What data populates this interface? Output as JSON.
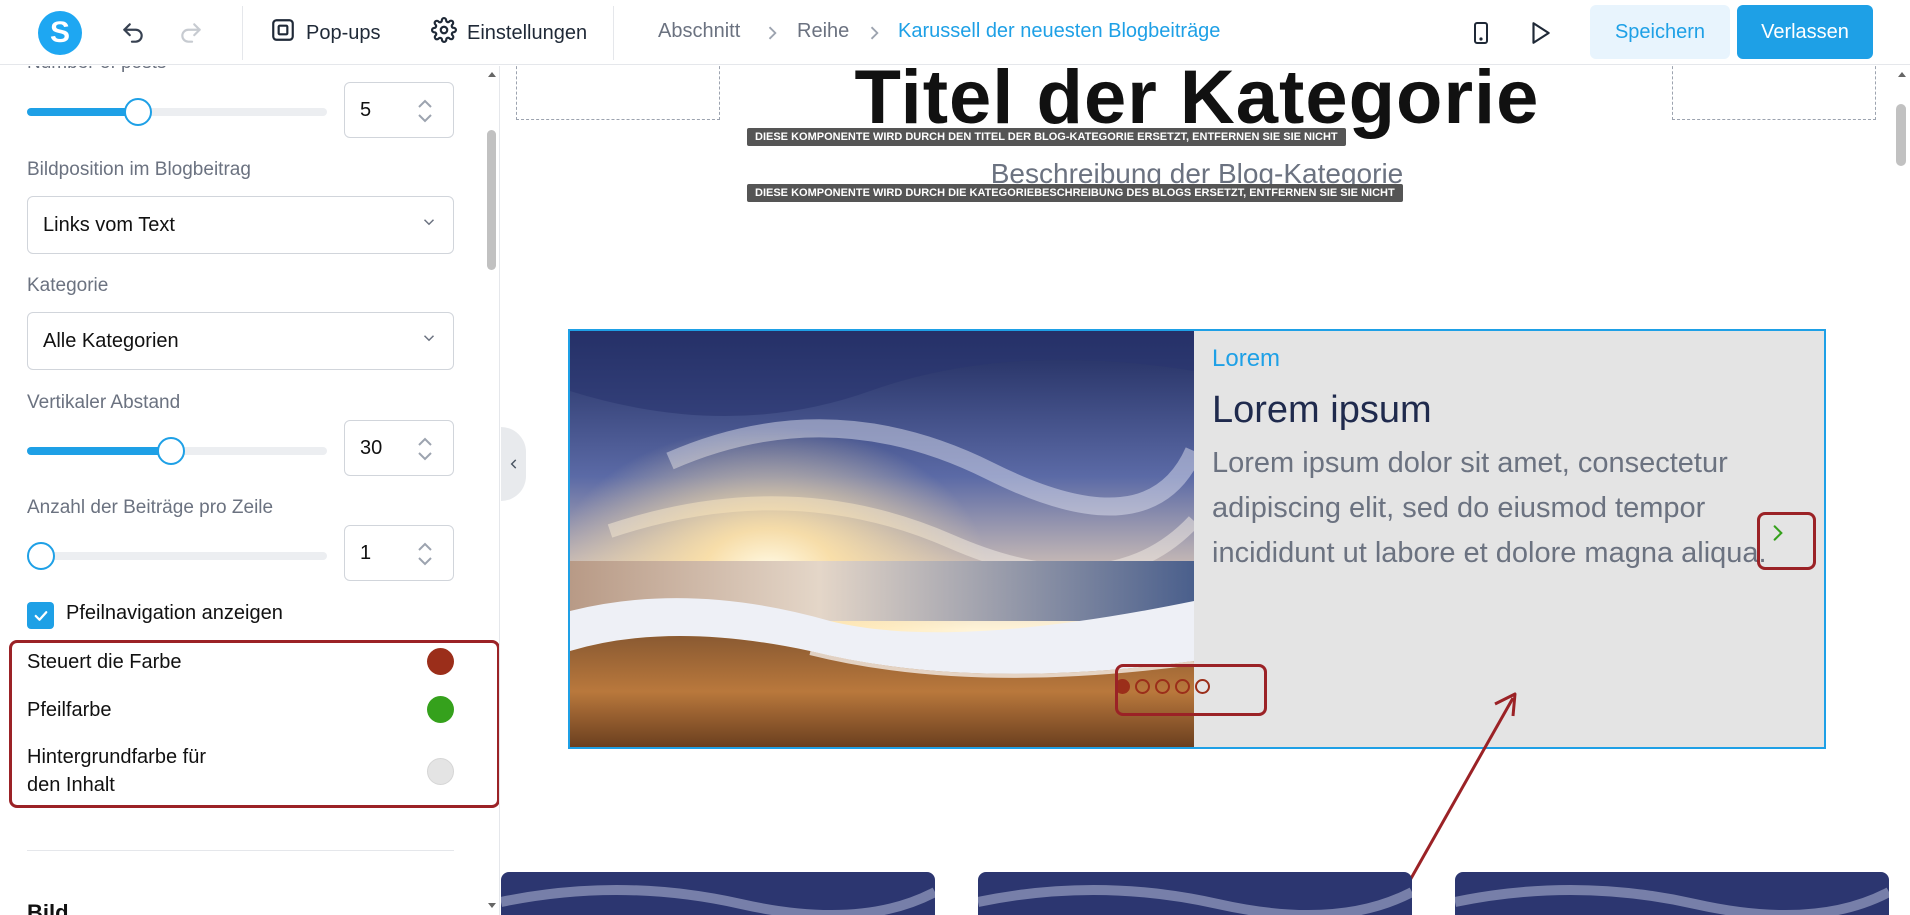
{
  "topbar": {
    "logo_letter": "S",
    "popups_label": "Pop-ups",
    "settings_label": "Einstellungen",
    "breadcrumbs": [
      "Abschnitt",
      "Reihe",
      "Karussell der neuesten Blogbeiträge"
    ],
    "save_label": "Speichern",
    "exit_label": "Verlassen"
  },
  "sidebar": {
    "posts_count": {
      "label": "Number of posts",
      "value": "5",
      "slider_fraction": 0.37
    },
    "image_position": {
      "label": "Bildposition im Blogbeitrag",
      "value": "Links vom Text"
    },
    "category": {
      "label": "Kategorie",
      "value": "Alle Kategorien"
    },
    "vertical_spacing": {
      "label": "Vertikaler Abstand",
      "value": "30",
      "slider_fraction": 0.48
    },
    "posts_per_row": {
      "label": "Anzahl der Beiträge pro Zeile",
      "value": "1",
      "slider_fraction": 0.0
    },
    "arrow_nav": {
      "label": "Pfeilnavigation anzeigen",
      "checked": true
    },
    "colors": [
      {
        "label": "Steuert die Farbe",
        "color": "#9b2e1a"
      },
      {
        "label": "Pfeilfarbe",
        "color": "#35a11c"
      },
      {
        "label_line1": "Hintergrundfarbe für",
        "label_line2": "den Inhalt",
        "color": "#e4e4e4"
      }
    ],
    "next_section": "Bild"
  },
  "canvas": {
    "category_title": "Titel der Kategorie",
    "title_badge": "DIESE KOMPONENTE WIRD DURCH DEN TITEL DER BLOG-KATEGORIE ERSETZT, ENTFERNEN SIE SIE NICHT",
    "description": "Beschreibung der Blog-Kategorie",
    "description_badge": "DIESE KOMPONENTE WIRD DURCH DIE KATEGORIEBESCHREIBUNG DES BLOGS ERSETZT, ENTFERNEN SIE SIE NICHT",
    "post": {
      "category": "Lorem",
      "title": "Lorem ipsum",
      "excerpt": "Lorem ipsum dolor sit amet, consectetur adipiscing elit, sed do eiusmod tempor incididunt ut labore et dolore magna aliqua."
    },
    "dots_total": 5,
    "active_dot": 1,
    "accent_color": "#1ea0e6",
    "highlight_color": "#9b2226"
  }
}
